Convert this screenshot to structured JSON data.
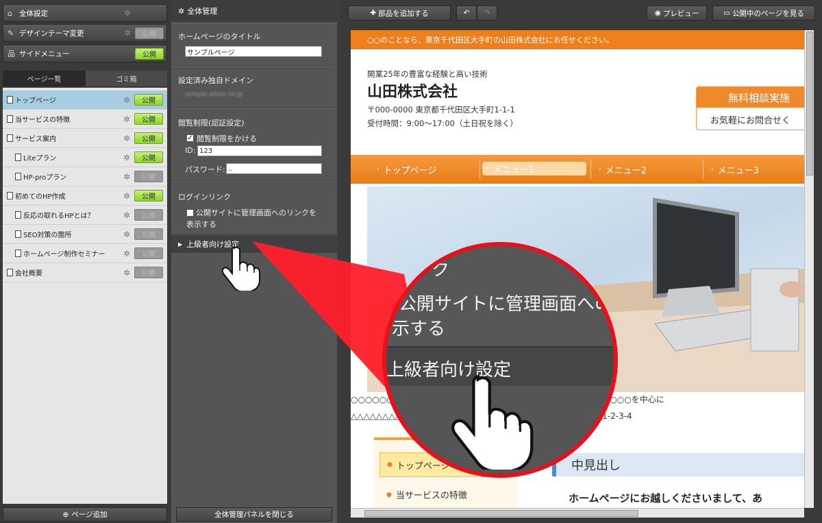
{
  "sidebar": {
    "top_buttons": [
      {
        "label": "全体設定",
        "icon": "home-icon"
      },
      {
        "label": "デザインテーマ変更",
        "icon": "brush-icon",
        "publish": "公開"
      },
      {
        "label": "サイドメニュー",
        "icon": "sitemap-icon",
        "publish": "公開"
      }
    ],
    "tabs": [
      "ページ一覧",
      "ゴミ箱"
    ],
    "pages": [
      {
        "label": "トップページ",
        "publish": "公開",
        "state": "on"
      },
      {
        "label": "当サービスの特徴",
        "publish": "公開",
        "state": "on"
      },
      {
        "label": "サービス案内",
        "publish": "公開",
        "state": "on"
      },
      {
        "label": "Liteプラン",
        "publish": "公開",
        "state": "on"
      },
      {
        "label": "HP-proプラン",
        "publish": "公開",
        "state": "off"
      },
      {
        "label": "初めてのHP作成",
        "publish": "公開",
        "state": "on"
      },
      {
        "label": "反応の取れるHPとは？",
        "publish": "公開",
        "state": "off"
      },
      {
        "label": "SEO対策の箇所",
        "publish": "公開",
        "state": "off"
      },
      {
        "label": "ホームページ制作セミナー",
        "publish": "公開",
        "state": "off"
      },
      {
        "label": "会社概要",
        "publish": "公開",
        "state": "off"
      }
    ],
    "add_page": "ページ追加"
  },
  "panel": {
    "title": "全体管理",
    "site_title_label": "ホームページのタイトル",
    "site_title_value": "サンプルページ",
    "domain_label": "設定済み独自ドメイン",
    "domain_value": "sample.aibas.ne.jp",
    "access_label": "閲覧制限(認証設定)",
    "access_checkbox": "閲覧制限をかける",
    "id_label": "ID:",
    "id_value": "123",
    "password_label": "パスワード:",
    "password_value": "..",
    "login_label": "ログインリンク",
    "login_checkbox": "公開サイトに管理画面へのリンクを表示する",
    "advanced": "上級者向け設定",
    "close": "全体管理パネルを閉じる"
  },
  "toolbar": {
    "add_part": "部品を追加する",
    "preview": "プレビュー",
    "view_public": "公開中のページを見る"
  },
  "site": {
    "banner": "○○のことなら、東京千代田区大手町の山田株式会社にお任せください。",
    "tagline": "開業25年の豊富な経験と高い技術",
    "company": "山田株式会社",
    "address": "〒000-0000 東京都千代田区大手町1-1-1",
    "hours": "受付時間：9:00～17:00（土日祝を除く）",
    "cta_top": "無料相談実施",
    "cta_bottom": "お気軽にお問合せく",
    "nav": [
      "トップページ",
      "メニュー1",
      "メニュー2",
      "メニュー3"
    ],
    "intro_1": "○○○○○○○○○○○○○○○○○○○○○○○○○○○○・××××・○○○○○を中心に",
    "intro_2": "△△△△△△△△△△△△△△△△△△△△△市××県○○○市　△△△△△△△△1-2-3-4",
    "subnav": [
      "トップページ",
      "当サービスの特徴"
    ],
    "h2": "中見出し",
    "welcome": "ホームページにお越しくださいまして、あ"
  },
  "magnifier": {
    "line1": "ンク",
    "line2": "公開サイトに管理画面へのリ",
    "line3": "示する",
    "line4": "上級者向け設定"
  }
}
